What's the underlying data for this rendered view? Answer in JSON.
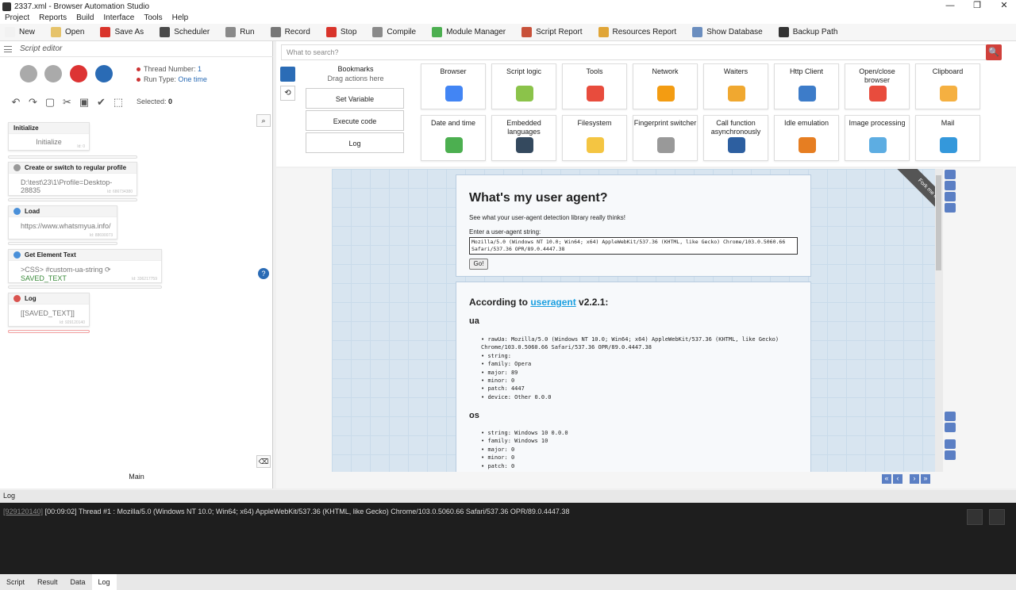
{
  "window": {
    "title": "2337.xml - Browser Automation Studio",
    "min": "—",
    "restore": "❐",
    "close": "✕"
  },
  "menu": [
    "Project",
    "Reports",
    "Build",
    "Interface",
    "Tools",
    "Help"
  ],
  "toolbar": [
    {
      "label": "New",
      "icon": "new-icon",
      "color": "#f2f2f2"
    },
    {
      "label": "Open",
      "icon": "folder-icon",
      "color": "#e6c36a"
    },
    {
      "label": "Save As",
      "icon": "save-icon",
      "color": "#d9342b"
    },
    {
      "label": "Scheduler",
      "icon": "calendar-icon",
      "color": "#4a4a4a"
    },
    {
      "label": "Run",
      "icon": "play-icon",
      "color": "#8a8a8a"
    },
    {
      "label": "Record",
      "icon": "record-icon",
      "color": "#777777"
    },
    {
      "label": "Stop",
      "icon": "stop-icon",
      "color": "#d9342b"
    },
    {
      "label": "Compile",
      "icon": "compile-icon",
      "color": "#8a8a8a"
    },
    {
      "label": "Module Manager",
      "icon": "puzzle-icon",
      "color": "#4caf50"
    },
    {
      "label": "Script Report",
      "icon": "pie-chart-icon",
      "color": "#c8513a"
    },
    {
      "label": "Resources Report",
      "icon": "report-icon",
      "color": "#e0a537"
    },
    {
      "label": "Show Database",
      "icon": "database-icon",
      "color": "#6b8ebf"
    },
    {
      "label": "Backup Path",
      "icon": "backup-icon",
      "color": "#333333"
    }
  ],
  "script_editor": {
    "title": "Script editor",
    "thread_label": "Thread Number:",
    "thread_value": "1",
    "run_type_label": "Run Type:",
    "run_type_value": "One time",
    "selected_label": "Selected:",
    "selected_value": "0",
    "main_label": "Main",
    "edit_icons": [
      "↶",
      "↷",
      "▢",
      "✂",
      "▣",
      "✔",
      "⬚"
    ],
    "nodes": [
      {
        "title": "Initialize",
        "body": "Initialize",
        "id": "Id: 0",
        "icon_color": ""
      },
      {
        "title": "Create or switch to regular profile",
        "body": "D:\\test\\23\\1\\Profile=Desktop-28835",
        "id": "Id: 686734380",
        "icon_color": "#999999"
      },
      {
        "title": "Load",
        "body": "https://www.whatsmyua.info/",
        "id": "Id: 88690073",
        "icon_color": "#4a90d9"
      },
      {
        "title": "Get Element Text",
        "body": ">CSS> #custom-ua-string",
        "body_extra": "SAVED_TEXT",
        "id": "Id: 336217759",
        "icon_color": "#4a90d9"
      },
      {
        "title": "Log",
        "body": "[[SAVED_TEXT]]",
        "id": "Id: 929120140",
        "icon_color": "#d9534f"
      }
    ]
  },
  "actions": {
    "search_placeholder": "What to search?",
    "search_icon": "🔍",
    "bookmarks_title": "Bookmarks",
    "bookmarks_sub": "Drag actions here",
    "bookmarks": [
      "Set Variable",
      "Execute code",
      "Log"
    ],
    "history_icon": "⟲",
    "categories": [
      {
        "label": "Browser",
        "color": "#4285f4"
      },
      {
        "label": "Script logic",
        "color": "#8bc34a"
      },
      {
        "label": "Tools",
        "color": "#e84c3d"
      },
      {
        "label": "Network",
        "color": "#f39c12"
      },
      {
        "label": "Waiters",
        "color": "#f0a830"
      },
      {
        "label": "Http Client",
        "color": "#3d7cc9"
      },
      {
        "label": "Open/close browser",
        "color": "#e84c3d"
      },
      {
        "label": "Clipboard",
        "color": "#f5b041"
      },
      {
        "label": "Date and time",
        "color": "#4caf50"
      },
      {
        "label": "Embedded languages",
        "color": "#34495e"
      },
      {
        "label": "Filesystem",
        "color": "#f4c542"
      },
      {
        "label": "Fingerprint switcher",
        "color": "#999999"
      },
      {
        "label": "Call function asynchronously",
        "color": "#2d5fa0"
      },
      {
        "label": "Idle emulation",
        "color": "#e67e22"
      },
      {
        "label": "Image processing",
        "color": "#5dade2"
      },
      {
        "label": "Mail",
        "color": "#3498db"
      }
    ]
  },
  "webpage": {
    "heading": "What's my user agent?",
    "subheading": "See what your user-agent detection library really thinks!",
    "input_label": "Enter a user-agent string:",
    "input_value": "Mozilla/5.0 (Windows NT 10.0; Win64; x64) AppleWebKit/537.36 (KHTML, like Gecko) Chrome/103.0.5060.66 Safari/537.36 OPR/89.0.4447.38",
    "go_button": "Go!",
    "ribbon": "Fork me on GitHub",
    "according_prefix": "According to",
    "according_link": "useragent",
    "according_suffix": "v2.2.1:",
    "ua_heading": "ua",
    "ua_items": [
      "rawUa: Mozilla/5.0 (Windows NT 10.0; Win64; x64) AppleWebKit/537.36 (KHTML, like Gecko)",
      "Chrome/103.0.5060.66 Safari/537.36 OPR/89.0.4447.38",
      "string:",
      "family: Opera",
      "major: 89",
      "minor: 0",
      "patch: 4447",
      "device: Other 0.0.0"
    ],
    "os_heading": "os",
    "os_items": [
      "string: Windows 10 0.0.0",
      "family: Windows 10",
      "major: 0",
      "minor: 0",
      "patch: 0"
    ]
  },
  "log": {
    "title": "Log",
    "entry_id": "[929120140]",
    "entry_text": "[00:09:02] Thread #1 : Mozilla/5.0 (Windows NT 10.0; Win64; x64) AppleWebKit/537.36 (KHTML, like Gecko) Chrome/103.0.5060.66 Safari/537.36 OPR/89.0.4447.38",
    "tabs": [
      "Script",
      "Result",
      "Data",
      "Log"
    ],
    "active_tab": "Log"
  }
}
